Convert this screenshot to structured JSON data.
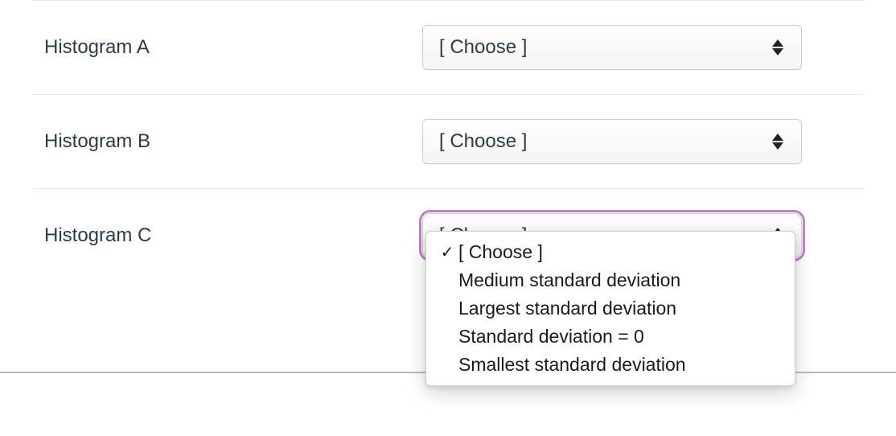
{
  "rows": [
    {
      "label": "Histogram A",
      "selected": "[ Choose ]",
      "open": false
    },
    {
      "label": "Histogram B",
      "selected": "[ Choose ]",
      "open": false
    },
    {
      "label": "Histogram C",
      "selected": "[ Choose ]",
      "open": true
    }
  ],
  "options": [
    {
      "label": "[ Choose ]",
      "checked": true
    },
    {
      "label": "Medium standard deviation",
      "checked": false
    },
    {
      "label": "Largest standard deviation",
      "checked": false
    },
    {
      "label": "Standard deviation = 0",
      "checked": false
    },
    {
      "label": "Smallest standard deviation",
      "checked": false
    }
  ]
}
